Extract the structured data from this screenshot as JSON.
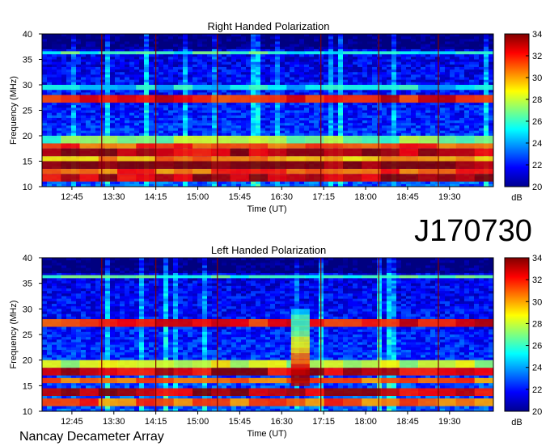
{
  "header": {
    "code": "J170730"
  },
  "footer": {
    "credit": "Nancay Decameter Array"
  },
  "colors": {
    "colormap": "jet",
    "frame": "#000000",
    "time_markers": "#800000",
    "background": "#ffffff"
  },
  "chart_data": [
    {
      "type": "heatmap",
      "title": "Right Handed Polarization",
      "xlabel": "Time (UT)",
      "ylabel": "Frequency (MHz)",
      "x_ticks": [
        "12:45",
        "13:30",
        "14:15",
        "15:00",
        "15:45",
        "16:30",
        "17:15",
        "18:00",
        "18:45",
        "19:30"
      ],
      "y_ticks": [
        10,
        15,
        20,
        25,
        30,
        35,
        40
      ],
      "ylim": [
        10,
        40
      ],
      "xlim": [
        "12:13",
        "20:17"
      ],
      "time_markers": [
        "13:17",
        "14:15",
        "15:21",
        "17:12",
        "18:14",
        "19:18"
      ],
      "colorbar": {
        "min": 20,
        "max": 34,
        "ticks": [
          20,
          22,
          24,
          26,
          28,
          30,
          32,
          34
        ],
        "unit": "dB",
        "colormap": "jet"
      },
      "bands": [
        {
          "freq": [
            11,
            12.5
          ],
          "level": 33
        },
        {
          "freq": [
            12.5,
            13.5
          ],
          "level": 31
        },
        {
          "freq": [
            13.5,
            15.0
          ],
          "level": 34
        },
        {
          "freq": [
            15.0,
            16.0
          ],
          "level": 30
        },
        {
          "freq": [
            16.0,
            17.5
          ],
          "level": 33
        },
        {
          "freq": [
            17.5,
            18.5
          ],
          "level": 31
        },
        {
          "freq": [
            18.5,
            20
          ],
          "level": 27
        },
        {
          "freq": [
            26.5,
            28
          ],
          "level": 32
        },
        {
          "freq": [
            29,
            30
          ],
          "level": 25
        },
        {
          "freq": [
            36,
            36.6
          ],
          "level": 26
        }
      ],
      "noise_floor": 23
    },
    {
      "type": "heatmap",
      "title": "Left Handed Polarization",
      "xlabel": "Time (UT)",
      "ylabel": "Frequency (MHz)",
      "x_ticks": [
        "12:45",
        "13:30",
        "14:15",
        "15:00",
        "15:45",
        "16:30",
        "17:15",
        "18:00",
        "18:45",
        "19:30"
      ],
      "y_ticks": [
        10,
        15,
        20,
        25,
        30,
        35,
        40
      ],
      "ylim": [
        10,
        40
      ],
      "xlim": [
        "12:13",
        "20:17"
      ],
      "time_markers": [
        "13:17",
        "14:15",
        "15:21",
        "17:12",
        "18:14",
        "19:18"
      ],
      "colorbar": {
        "min": 20,
        "max": 34,
        "ticks": [
          20,
          22,
          24,
          26,
          28,
          30,
          32,
          34
        ],
        "unit": "dB",
        "colormap": "jet"
      },
      "bands": [
        {
          "freq": [
            11,
            12.5
          ],
          "level": 31
        },
        {
          "freq": [
            13,
            14.5
          ],
          "level": 33
        },
        {
          "freq": [
            15.5,
            16.5
          ],
          "level": 31
        },
        {
          "freq": [
            17,
            18.5
          ],
          "level": 33
        },
        {
          "freq": [
            18.5,
            20
          ],
          "level": 28
        },
        {
          "freq": [
            26.5,
            28
          ],
          "level": 32
        },
        {
          "freq": [
            36,
            36.6
          ],
          "level": 26
        }
      ],
      "events": [
        {
          "time": [
            "16:40",
            "17:00"
          ],
          "freq": [
            15,
            30
          ],
          "level": 30
        }
      ],
      "noise_floor": 23
    }
  ]
}
